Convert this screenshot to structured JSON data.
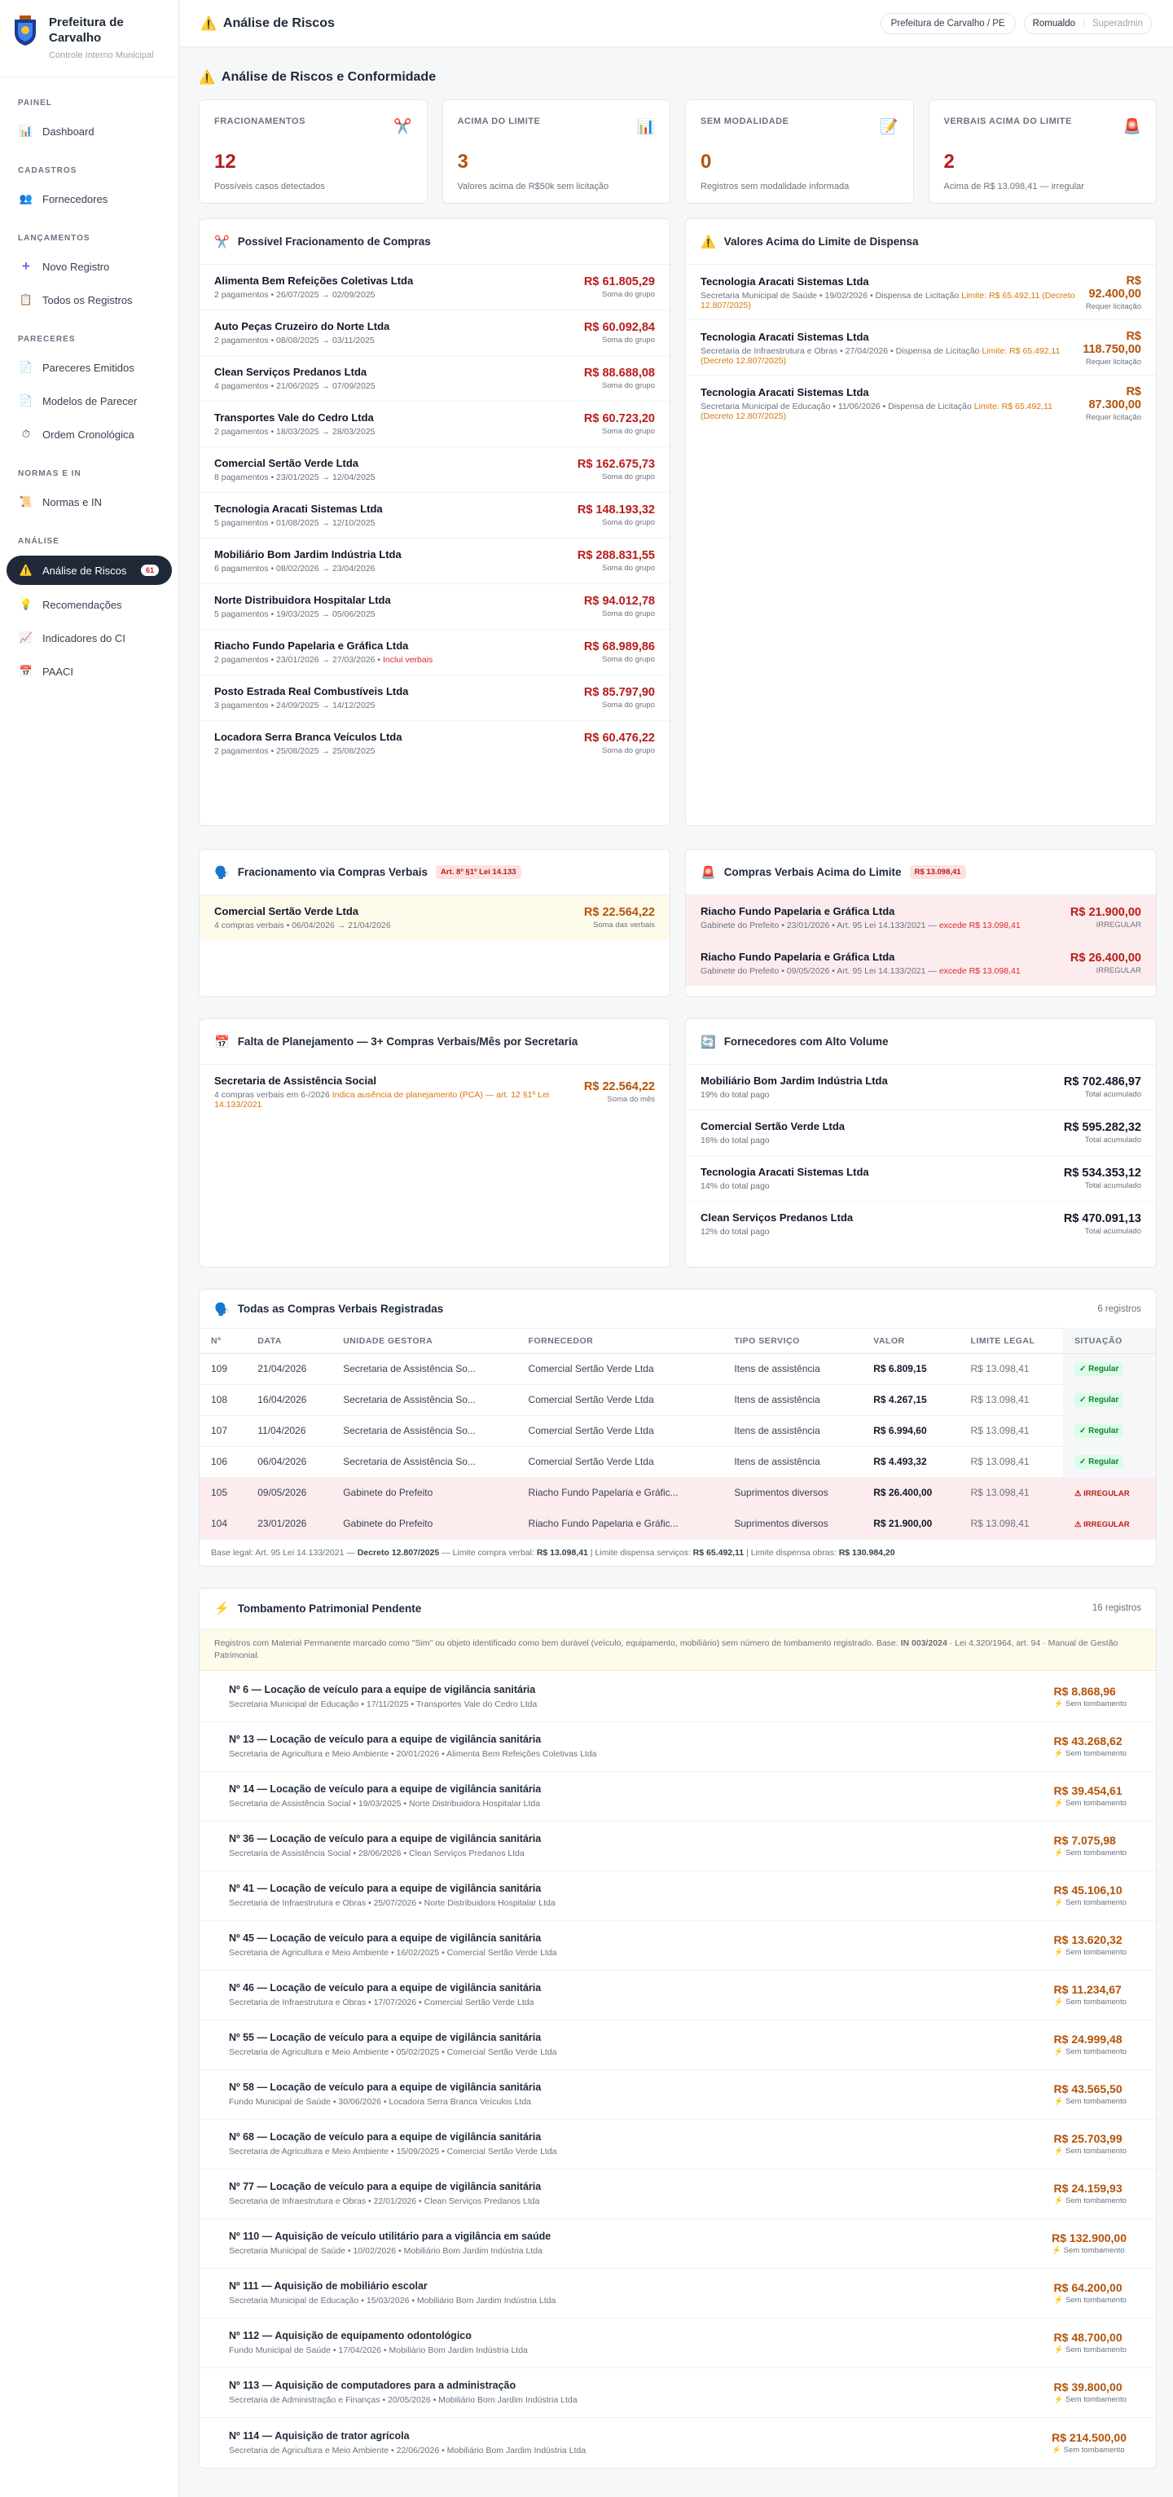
{
  "brand": {
    "title": "Prefeitura de Carvalho",
    "subtitle": "Controle Interno Municipal"
  },
  "nav": {
    "s1": "PAINEL",
    "dashboard": "Dashboard",
    "s2": "CADASTROS",
    "fornecedores": "Fornecedores",
    "s3": "LANÇAMENTOS",
    "novo": "Novo Registro",
    "todos": "Todos os Registros",
    "s4": "PARECERES",
    "pareceres": "Pareceres Emitidos",
    "modelos": "Modelos de Parecer",
    "ordem": "Ordem Cronológica",
    "s5": "NORMAS E IN",
    "normas": "Normas e IN",
    "s6": "ANÁLISE",
    "analise": "Análise de Riscos",
    "analise_badge": "61",
    "recom": "Recomendações",
    "indic": "Indicadores do CI",
    "paaci": "PAACI"
  },
  "topbar": {
    "title": "Análise de Riscos",
    "org": "Prefeitura de Carvalho / PE",
    "user": "Romualdo",
    "role": "Superadmin"
  },
  "page": {
    "heading": "Análise de Riscos e Conformidade"
  },
  "stats": [
    {
      "label": "FRACIONAMENTOS",
      "value": "12",
      "desc": "Possíveis casos detectados",
      "color": "#b91c1c"
    },
    {
      "label": "ACIMA DO LIMITE",
      "value": "3",
      "desc": "Valores acima de R$50k sem licitação",
      "color": "#b45309"
    },
    {
      "label": "SEM MODALIDADE",
      "value": "0",
      "desc": "Registros sem modalidade informada",
      "color": "#b45309"
    },
    {
      "label": "VERBAIS ACIMA DO LIMITE",
      "value": "2",
      "desc": "Acima de R$ 13.098,41 — irregular",
      "color": "#b91c1c"
    }
  ],
  "frac": {
    "title": "Possível Fracionamento de Compras",
    "items": [
      {
        "name": "Alimenta Bem Refeições Coletivas Ltda",
        "sub": "2 pagamentos • 26/07/2025 → 02/09/2025",
        "extra": "",
        "amount": "R$ 61.805,29",
        "note": "Soma do grupo"
      },
      {
        "name": "Auto Peças Cruzeiro do Norte Ltda",
        "sub": "2 pagamentos • 08/08/2025 → 03/11/2025",
        "extra": "",
        "amount": "R$ 60.092,84",
        "note": "Soma do grupo"
      },
      {
        "name": "Clean Serviços Predanos Ltda",
        "sub": "4 pagamentos • 21/06/2025 → 07/09/2025",
        "extra": "",
        "amount": "R$ 88.688,08",
        "note": "Soma do grupo"
      },
      {
        "name": "Transportes Vale do Cedro Ltda",
        "sub": "2 pagamentos • 18/03/2025 → 28/03/2025",
        "extra": "",
        "amount": "R$ 60.723,20",
        "note": "Soma do grupo"
      },
      {
        "name": "Comercial Sertão Verde Ltda",
        "sub": "8 pagamentos • 23/01/2025 → 12/04/2025",
        "extra": "",
        "amount": "R$ 162.675,73",
        "note": "Soma do grupo"
      },
      {
        "name": "Tecnologia Aracati Sistemas Ltda",
        "sub": "5 pagamentos • 01/08/2025 → 12/10/2025",
        "extra": "",
        "amount": "R$ 148.193,32",
        "note": "Soma do grupo"
      },
      {
        "name": "Mobiliário Bom Jardim Indústria Ltda",
        "sub": "6 pagamentos • 08/02/2026 → 23/04/2026",
        "extra": "",
        "amount": "R$ 288.831,55",
        "note": "Soma do grupo"
      },
      {
        "name": "Norte Distribuidora Hospitalar Ltda",
        "sub": "5 pagamentos • 19/03/2025 → 05/06/2025",
        "extra": "",
        "amount": "R$ 94.012,78",
        "note": "Soma do grupo"
      },
      {
        "name": "Riacho Fundo Papelaria e Gráfica Ltda",
        "sub": "2 pagamentos • 23/01/2026 → 27/03/2026 •",
        "extra": "Inclui verbais",
        "amount": "R$ 68.989,86",
        "note": "Soma do grupo"
      },
      {
        "name": "Posto Estrada Real Combustíveis Ltda",
        "sub": "3 pagamentos • 24/09/2025 → 14/12/2025",
        "extra": "",
        "amount": "R$ 85.797,90",
        "note": "Soma do grupo"
      },
      {
        "name": "Locadora Serra Branca Veículos Ltda",
        "sub": "2 pagamentos • 25/08/2025 → 25/08/2025",
        "extra": "",
        "amount": "R$ 60.476,22",
        "note": "Soma do grupo"
      }
    ]
  },
  "limite": {
    "title": "Valores Acima do Limite de Dispensa",
    "items": [
      {
        "name": "Tecnologia Aracati Sistemas Ltda",
        "sub": "Secretaria Municipal de Saúde • 19/02/2026 • Dispensa de Licitação",
        "hl": "Limite: R$ 65.492,11 (Decreto 12.807/2025)",
        "amt1": "R$",
        "amt2": "92.400,00",
        "note": "Requer licitação"
      },
      {
        "name": "Tecnologia Aracati Sistemas Ltda",
        "sub": "Secretaria de Infraestrutura e Obras • 27/04/2026 • Dispensa de Licitação",
        "hl": "Limite: R$ 65.492,11 (Decreto 12.807/2025)",
        "amt1": "R$",
        "amt2": "118.750,00",
        "note": "Requer licitação"
      },
      {
        "name": "Tecnologia Aracati Sistemas Ltda",
        "sub": "Secretaria Municipal de Educação • 11/06/2026 • Dispensa de Licitação",
        "hl": "Limite: R$ 65.492,11 (Decreto 12.807/2025)",
        "amt1": "R$",
        "amt2": "87.300,00",
        "note": "Requer licitação"
      }
    ]
  },
  "fverb": {
    "title": "Fracionamento via Compras Verbais",
    "tag": "Art. 8º §1º Lei 14.133",
    "items": [
      {
        "name": "Comercial Sertão Verde Ltda",
        "sub": "4 compras verbais • 06/04/2026 → 21/04/2026",
        "amount": "R$ 22.564,22",
        "note": "Soma das verbais"
      }
    ]
  },
  "cverb": {
    "title": "Compras Verbais Acima do Limite",
    "tag": "R$ 13.098,41",
    "items": [
      {
        "name": "Riacho Fundo Papelaria e Gráfica Ltda",
        "sub": "Gabinete do Prefeito • 23/01/2026 • Art. 95 Lei 14.133/2021 —",
        "hl": "excede R$ 13.098,41",
        "amount": "R$ 21.900,00",
        "note": "IRREGULAR"
      },
      {
        "name": "Riacho Fundo Papelaria e Gráfica Ltda",
        "sub": "Gabinete do Prefeito • 09/05/2026 • Art. 95 Lei 14.133/2021 —",
        "hl": "excede R$ 13.098,41",
        "amount": "R$ 26.400,00",
        "note": "IRREGULAR"
      }
    ]
  },
  "plan": {
    "title": "Falta de Planejamento — 3+ Compras Verbais/Mês por Secretaria",
    "items": [
      {
        "name": "Secretaria de Assistência Social",
        "sub": "4 compras verbais em 6-/2026",
        "hl": "Indica ausência de planejamento (PCA) — art. 12 §1º Lei 14.133/2021",
        "amount": "R$ 22.564,22",
        "note": "Soma do mês"
      }
    ]
  },
  "forn": {
    "title": "Fornecedores com Alto Volume",
    "items": [
      {
        "name": "Mobiliário Bom Jardim Indústria Ltda",
        "sub": "19% do total pago",
        "amount": "R$ 702.486,97",
        "note": "Total acumulado"
      },
      {
        "name": "Comercial Sertão Verde Ltda",
        "sub": "16% do total pago",
        "amount": "R$ 595.282,32",
        "note": "Total acumulado"
      },
      {
        "name": "Tecnologia Aracati Sistemas Ltda",
        "sub": "14% do total pago",
        "amount": "R$ 534.353,12",
        "note": "Total acumulado"
      },
      {
        "name": "Clean Serviços Predanos Ltda",
        "sub": "12% do total pago",
        "amount": "R$ 470.091,13",
        "note": "Total acumulado"
      }
    ]
  },
  "table": {
    "title": "Todas as Compras Verbais Registradas",
    "count": "6 registros",
    "headers": [
      "Nº",
      "DATA",
      "UNIDADE GESTORA",
      "FORNECEDOR",
      "TIPO SERVIÇO",
      "VALOR",
      "LIMITE LEGAL",
      "SITUAÇÃO"
    ],
    "rows": [
      {
        "n": "109",
        "d": "21/04/2026",
        "u": "Secretaria de Assistência So...",
        "f": "Comercial Sertão Verde Ltda",
        "t": "Itens de assistência",
        "v": "R$ 6.809,15",
        "l": "R$ 13.098,41",
        "s": "✓ Regular",
        "irr": false
      },
      {
        "n": "108",
        "d": "16/04/2026",
        "u": "Secretaria de Assistência So...",
        "f": "Comercial Sertão Verde Ltda",
        "t": "Itens de assistência",
        "v": "R$ 4.267,15",
        "l": "R$ 13.098,41",
        "s": "✓ Regular",
        "irr": false
      },
      {
        "n": "107",
        "d": "11/04/2026",
        "u": "Secretaria de Assistência So...",
        "f": "Comercial Sertão Verde Ltda",
        "t": "Itens de assistência",
        "v": "R$ 6.994,60",
        "l": "R$ 13.098,41",
        "s": "✓ Regular",
        "irr": false
      },
      {
        "n": "106",
        "d": "06/04/2026",
        "u": "Secretaria de Assistência So...",
        "f": "Comercial Sertão Verde Ltda",
        "t": "Itens de assistência",
        "v": "R$ 4.493,32",
        "l": "R$ 13.098,41",
        "s": "✓ Regular",
        "irr": false
      },
      {
        "n": "105",
        "d": "09/05/2026",
        "u": "Gabinete do Prefeito",
        "f": "Riacho Fundo Papelaria e Gráfic...",
        "t": "Suprimentos diversos",
        "v": "R$ 26.400,00",
        "l": "R$ 13.098,41",
        "s": "⚠ IRREGULAR",
        "irr": true
      },
      {
        "n": "104",
        "d": "23/01/2026",
        "u": "Gabinete do Prefeito",
        "f": "Riacho Fundo Papelaria e Gráfic...",
        "t": "Suprimentos diversos",
        "v": "R$ 21.900,00",
        "l": "R$ 13.098,41",
        "s": "⚠ IRREGULAR",
        "irr": true
      }
    ],
    "foot_a": "Base legal: Art. 95 Lei 14.133/2021 — ",
    "foot_b": "Decreto 12.807/2025",
    "foot_c": " — Limite compra verbal: ",
    "foot_d": "R$ 13.098,41",
    "foot_e": " | Limite dispensa serviços: ",
    "foot_f": "R$ 65.492,11",
    "foot_g": " | Limite dispensa obras: ",
    "foot_h": "R$ 130.984,20"
  },
  "tomb": {
    "title": "Tombamento Patrimonial Pendente",
    "count": "16 registros",
    "notice_a": "Registros com Material Permanente marcado como \"Sim\" ou objeto identificado como bem durável (veículo, equipamento, mobiliário) sem número de tombamento registrado. Base: ",
    "notice_b": "IN 003/2024",
    "notice_c": " · Lei 4.320/1964, art. 94 · Manual de Gestão Patrimonial.",
    "items": [
      {
        "name": "Nº 6 — Locação de veículo para a equipe de vigilância sanitária",
        "sub": "Secretaria Municipal de Educação • 17/11/2025 • Transportes Vale do Cedro Ltda",
        "amount": "R$ 8.868,96",
        "note": "⚡ Sem tombamento"
      },
      {
        "name": "Nº 13 — Locação de veículo para a equipe de vigilância sanitária",
        "sub": "Secretaria de Agricultura e Meio Ambiente • 20/01/2026 • Alimenta Bem Refeições Coletivas Ltda",
        "amount": "R$ 43.268,62",
        "note": "⚡ Sem tombamento"
      },
      {
        "name": "Nº 14 — Locação de veículo para a equipe de vigilância sanitária",
        "sub": "Secretaria de Assistência Social • 19/03/2025 • Norte Distribuidora Hospitalar Ltda",
        "amount": "R$ 39.454,61",
        "note": "⚡ Sem tombamento"
      },
      {
        "name": "Nº 36 — Locação de veículo para a equipe de vigilância sanitária",
        "sub": "Secretaria de Assistência Social • 28/06/2026 • Clean Serviços Predanos Ltda",
        "amount": "R$ 7.075,98",
        "note": "⚡ Sem tombamento"
      },
      {
        "name": "Nº 41 — Locação de veículo para a equipe de vigilância sanitária",
        "sub": "Secretaria de Infraestrutura e Obras • 25/07/2026 • Norte Distribuidora Hospitalar Ltda",
        "amount": "R$ 45.106,10",
        "note": "⚡ Sem tombamento"
      },
      {
        "name": "Nº 45 — Locação de veículo para a equipe de vigilância sanitária",
        "sub": "Secretaria de Agricultura e Meio Ambiente • 16/02/2025 • Comercial Sertão Verde Ltda",
        "amount": "R$ 13.620,32",
        "note": "⚡ Sem tombamento"
      },
      {
        "name": "Nº 46 — Locação de veículo para a equipe de vigilância sanitária",
        "sub": "Secretaria de Infraestrutura e Obras • 17/07/2026 • Comercial Sertão Verde Ltda",
        "amount": "R$ 11.234,67",
        "note": "⚡ Sem tombamento"
      },
      {
        "name": "Nº 55 — Locação de veículo para a equipe de vigilância sanitária",
        "sub": "Secretaria de Agricultura e Meio Ambiente • 05/02/2025 • Comercial Sertão Verde Ltda",
        "amount": "R$ 24.999,48",
        "note": "⚡ Sem tombamento"
      },
      {
        "name": "Nº 58 — Locação de veículo para a equipe de vigilância sanitária",
        "sub": "Fundo Municipal de Saúde • 30/06/2026 • Locadora Serra Branca Veículos Ltda",
        "amount": "R$ 43.565,50",
        "note": "⚡ Sem tombamento"
      },
      {
        "name": "Nº 68 — Locação de veículo para a equipe de vigilância sanitária",
        "sub": "Secretaria de Agricultura e Meio Ambiente • 15/09/2025 • Comercial Sertão Verde Ltda",
        "amount": "R$ 25.703,99",
        "note": "⚡ Sem tombamento"
      },
      {
        "name": "Nº 77 — Locação de veículo para a equipe de vigilância sanitária",
        "sub": "Secretaria de Infraestrutura e Obras • 22/01/2026 • Clean Serviços Predanos Ltda",
        "amount": "R$ 24.159,93",
        "note": "⚡ Sem tombamento"
      },
      {
        "name": "Nº 110 — Aquisição de veículo utilitário para a vigilância em saúde",
        "sub": "Secretaria Municipal de Saúde • 10/02/2026 • Mobiliário Bom Jardim Indústria Ltda",
        "amount": "R$ 132.900,00",
        "note": "⚡ Sem tombamento"
      },
      {
        "name": "Nº 111 — Aquisição de mobiliário escolar",
        "sub": "Secretaria Municipal de Educação • 15/03/2026 • Mobiliário Bom Jardim Indústria Ltda",
        "amount": "R$ 64.200,00",
        "note": "⚡ Sem tombamento"
      },
      {
        "name": "Nº 112 — Aquisição de equipamento odontológico",
        "sub": "Fundo Municipal de Saúde • 17/04/2026 • Mobiliário Bom Jardim Indústria Ltda",
        "amount": "R$ 48.700,00",
        "note": "⚡ Sem tombamento"
      },
      {
        "name": "Nº 113 — Aquisição de computadores para a administração",
        "sub": "Secretaria de Administração e Finanças • 20/05/2026 • Mobiliário Bom Jardim Indústria Ltda",
        "amount": "R$ 39.800,00",
        "note": "⚡ Sem tombamento"
      },
      {
        "name": "Nº 114 — Aquisição de trator agrícola",
        "sub": "Secretaria de Agricultura e Meio Ambiente • 22/06/2026 • Mobiliário Bom Jardim Indústria Ltda",
        "amount": "R$ 214.500,00",
        "note": "⚡ Sem tombamento"
      }
    ]
  }
}
